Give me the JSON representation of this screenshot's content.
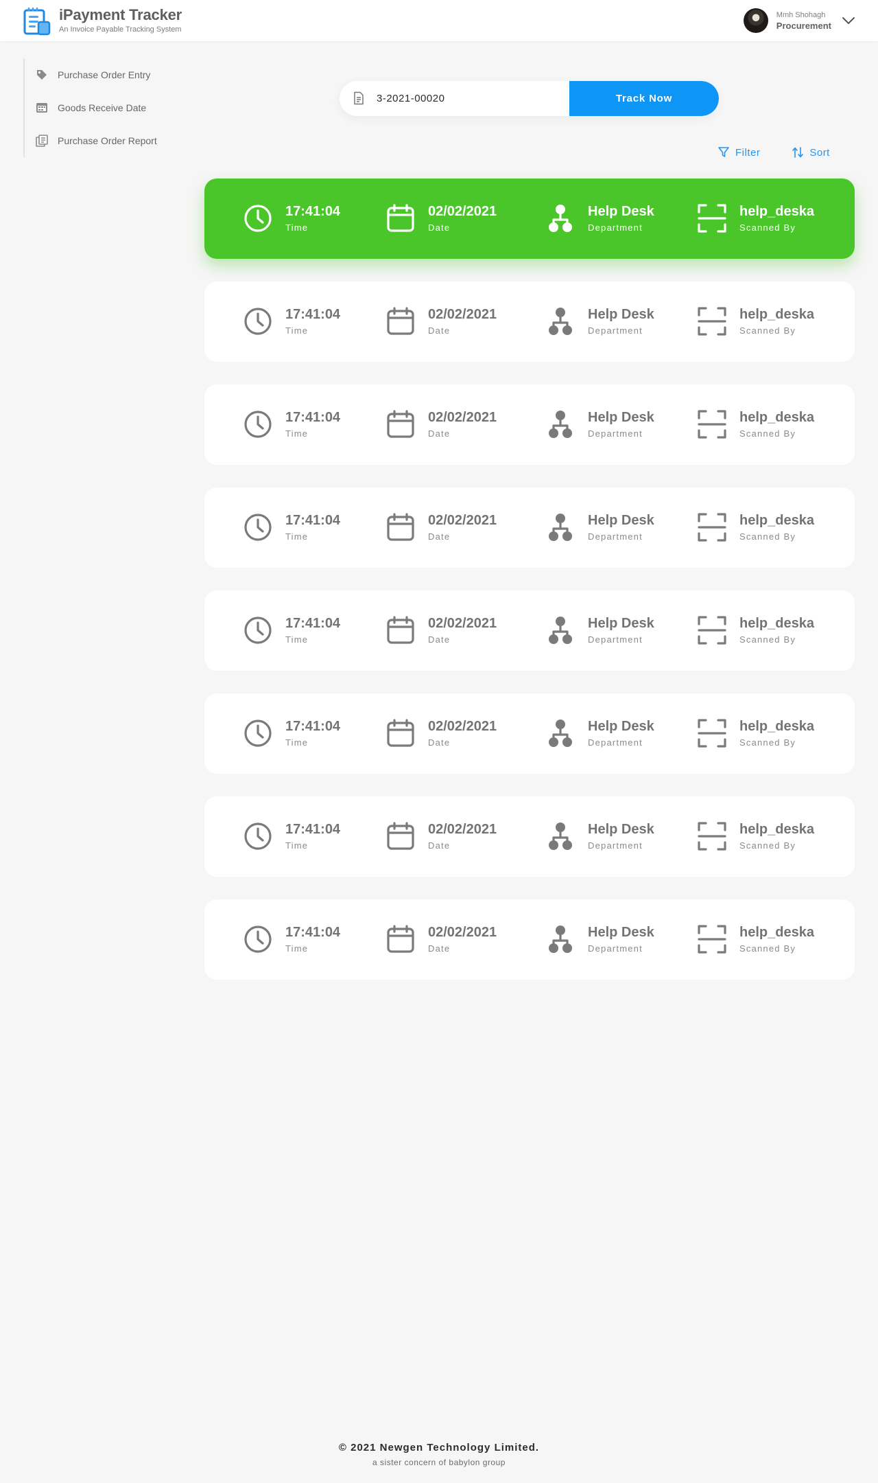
{
  "app": {
    "title": "iPayment Tracker",
    "subtitle": "An Invoice Payable Tracking System"
  },
  "user": {
    "name": "Mmh Shohagh",
    "role": "Procurement"
  },
  "sidebar": {
    "items": [
      {
        "label": "Purchase Order Entry",
        "icon": "tag-icon"
      },
      {
        "label": "Goods Receive Date",
        "icon": "calendar-grid-icon"
      },
      {
        "label": "Purchase Order Report",
        "icon": "report-icon"
      }
    ]
  },
  "search": {
    "value": "3-2021-00020",
    "button_label": "Track Now"
  },
  "toolbar": {
    "filter_label": "Filter",
    "sort_label": "Sort"
  },
  "records": [
    {
      "time": "17:41:04",
      "time_label": "Time",
      "date": "02/02/2021",
      "date_label": "Date",
      "department": "Help Desk",
      "department_label": "Department",
      "scanned_by": "help_deska",
      "scanned_label": "Scanned By",
      "active": true
    },
    {
      "time": "17:41:04",
      "time_label": "Time",
      "date": "02/02/2021",
      "date_label": "Date",
      "department": "Help Desk",
      "department_label": "Department",
      "scanned_by": "help_deska",
      "scanned_label": "Scanned By",
      "active": false
    },
    {
      "time": "17:41:04",
      "time_label": "Time",
      "date": "02/02/2021",
      "date_label": "Date",
      "department": "Help Desk",
      "department_label": "Department",
      "scanned_by": "help_deska",
      "scanned_label": "Scanned By",
      "active": false
    },
    {
      "time": "17:41:04",
      "time_label": "Time",
      "date": "02/02/2021",
      "date_label": "Date",
      "department": "Help Desk",
      "department_label": "Department",
      "scanned_by": "help_deska",
      "scanned_label": "Scanned By",
      "active": false
    },
    {
      "time": "17:41:04",
      "time_label": "Time",
      "date": "02/02/2021",
      "date_label": "Date",
      "department": "Help Desk",
      "department_label": "Department",
      "scanned_by": "help_deska",
      "scanned_label": "Scanned By",
      "active": false
    },
    {
      "time": "17:41:04",
      "time_label": "Time",
      "date": "02/02/2021",
      "date_label": "Date",
      "department": "Help Desk",
      "department_label": "Department",
      "scanned_by": "help_deska",
      "scanned_label": "Scanned By",
      "active": false
    },
    {
      "time": "17:41:04",
      "time_label": "Time",
      "date": "02/02/2021",
      "date_label": "Date",
      "department": "Help Desk",
      "department_label": "Department",
      "scanned_by": "help_deska",
      "scanned_label": "Scanned By",
      "active": false
    },
    {
      "time": "17:41:04",
      "time_label": "Time",
      "date": "02/02/2021",
      "date_label": "Date",
      "department": "Help Desk",
      "department_label": "Department",
      "scanned_by": "help_deska",
      "scanned_label": "Scanned By",
      "active": false
    }
  ],
  "footer": {
    "copyright": "© 2021 Newgen Technology Limited.",
    "tagline": "a sister concern of babylon group"
  },
  "colors": {
    "accent": "#0e96f6",
    "active_card": "#4ac62a",
    "icon_gray": "#7a7a7a",
    "background": "#f6f6f6"
  }
}
